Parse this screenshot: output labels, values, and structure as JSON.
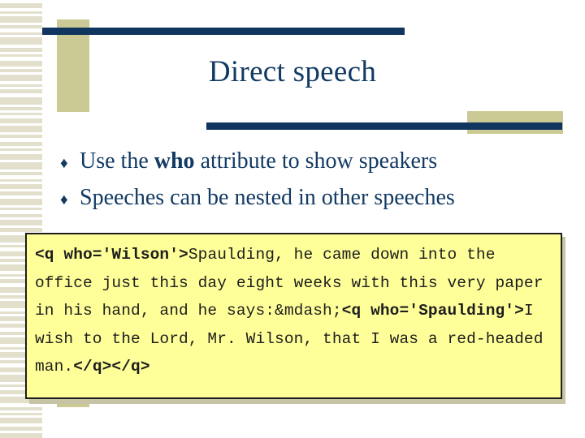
{
  "slide": {
    "title": "Direct speech",
    "bullets": [
      {
        "marker": "♦",
        "pre": "Use the ",
        "bold": "who",
        "post": " attribute to show speakers"
      },
      {
        "marker": "♦",
        "pre": "Speeches can be nested in other speeches",
        "bold": "",
        "post": ""
      }
    ],
    "code": {
      "seg1_bold": "<q who='Wilson'>",
      "seg2": "Spaulding, he came down into the office just this day eight weeks with this very paper in his hand, and he says:&mdash;",
      "seg3_bold": "<q who='Spaulding'>",
      "seg4": "I wish to the Lord, Mr. Wilson, that I was a red-headed man.",
      "seg5_bold": "</q></q>"
    }
  },
  "colors": {
    "navy": "#10365f",
    "title_navy": "#123a63",
    "beige_block": "#cbc994",
    "stripe": "#e2e0cd",
    "code_bg": "#ffff99",
    "code_border": "#1d1d1d",
    "code_shadow": "#c6c4a4"
  }
}
